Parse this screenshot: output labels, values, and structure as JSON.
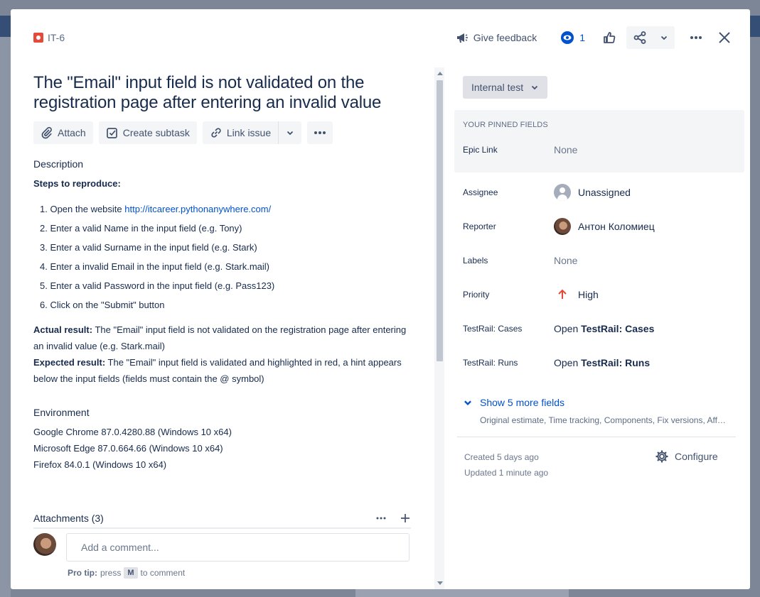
{
  "issue": {
    "key": "IT-6",
    "title": "The \"Email\" input field is not validated on the registration page after entering an invalid value"
  },
  "header": {
    "give_feedback": "Give feedback",
    "watchers_count": "1"
  },
  "toolbar": {
    "attach": "Attach",
    "create_subtask": "Create subtask",
    "link_issue": "Link issue"
  },
  "description": {
    "label": "Description",
    "steps_heading": "Steps to reproduce:",
    "step1_prefix": "Open the website ",
    "step1_link": "http://itcareer.pythonanywhere.com/",
    "steps": [
      "Enter a valid Name in the input field (e.g. Tony)",
      "Enter a valid Surname in the input field (e.g. Stark)",
      "Enter a invalid Email in the input field (e.g. Stark.mail)",
      "Enter a valid Password in the input field (e.g. Pass123)",
      "Click on the \"Submit\" button"
    ],
    "actual_label": "Actual result:",
    "actual_text": " The \"Email\" input field is not validated on the registration page after entering an invalid value (e.g. Stark.mail)",
    "expected_label": "Expected result:",
    "expected_text": " The \"Email\" input field is validated and highlighted in red, a hint appears below the input fields (fields must contain the @ symbol)"
  },
  "environment": {
    "label": "Environment",
    "lines": [
      "Google Chrome 87.0.4280.88 (Windows 10 x64)",
      "Microsoft Edge 87.0.664.66  (Windows 10 x64)",
      "Firefox 84.0.1  (Windows 10 x64)"
    ]
  },
  "attachments": {
    "label": "Attachments (3)"
  },
  "comment": {
    "placeholder": "Add a comment...",
    "protip_label": "Pro tip:",
    "protip_press": "press",
    "protip_key": "M",
    "protip_suffix": "to comment"
  },
  "sidebar": {
    "status": "Internal test",
    "pinned_title": "YOUR PINNED FIELDS",
    "fields": {
      "epic_link": {
        "label": "Epic Link",
        "value": "None"
      },
      "assignee": {
        "label": "Assignee",
        "value": "Unassigned"
      },
      "reporter": {
        "label": "Reporter",
        "value": "Антон Коломиец"
      },
      "labels": {
        "label": "Labels",
        "value": "None"
      },
      "priority": {
        "label": "Priority",
        "value": "High"
      },
      "tr_cases": {
        "label": "TestRail: Cases",
        "value_prefix": "Open ",
        "value_bold": "TestRail: Cases"
      },
      "tr_runs": {
        "label": "TestRail: Runs",
        "value_prefix": "Open ",
        "value_bold": "TestRail: Runs"
      }
    },
    "show_more": "Show 5 more fields",
    "show_more_sub": "Original estimate, Time tracking, Components, Fix versions, Affe...",
    "created": "Created 5 days ago",
    "updated": "Updated 1 minute ago",
    "configure": "Configure"
  },
  "colors": {
    "link": "#0052cc",
    "bug": "#e5493a",
    "priority_high": "#e5493a"
  }
}
